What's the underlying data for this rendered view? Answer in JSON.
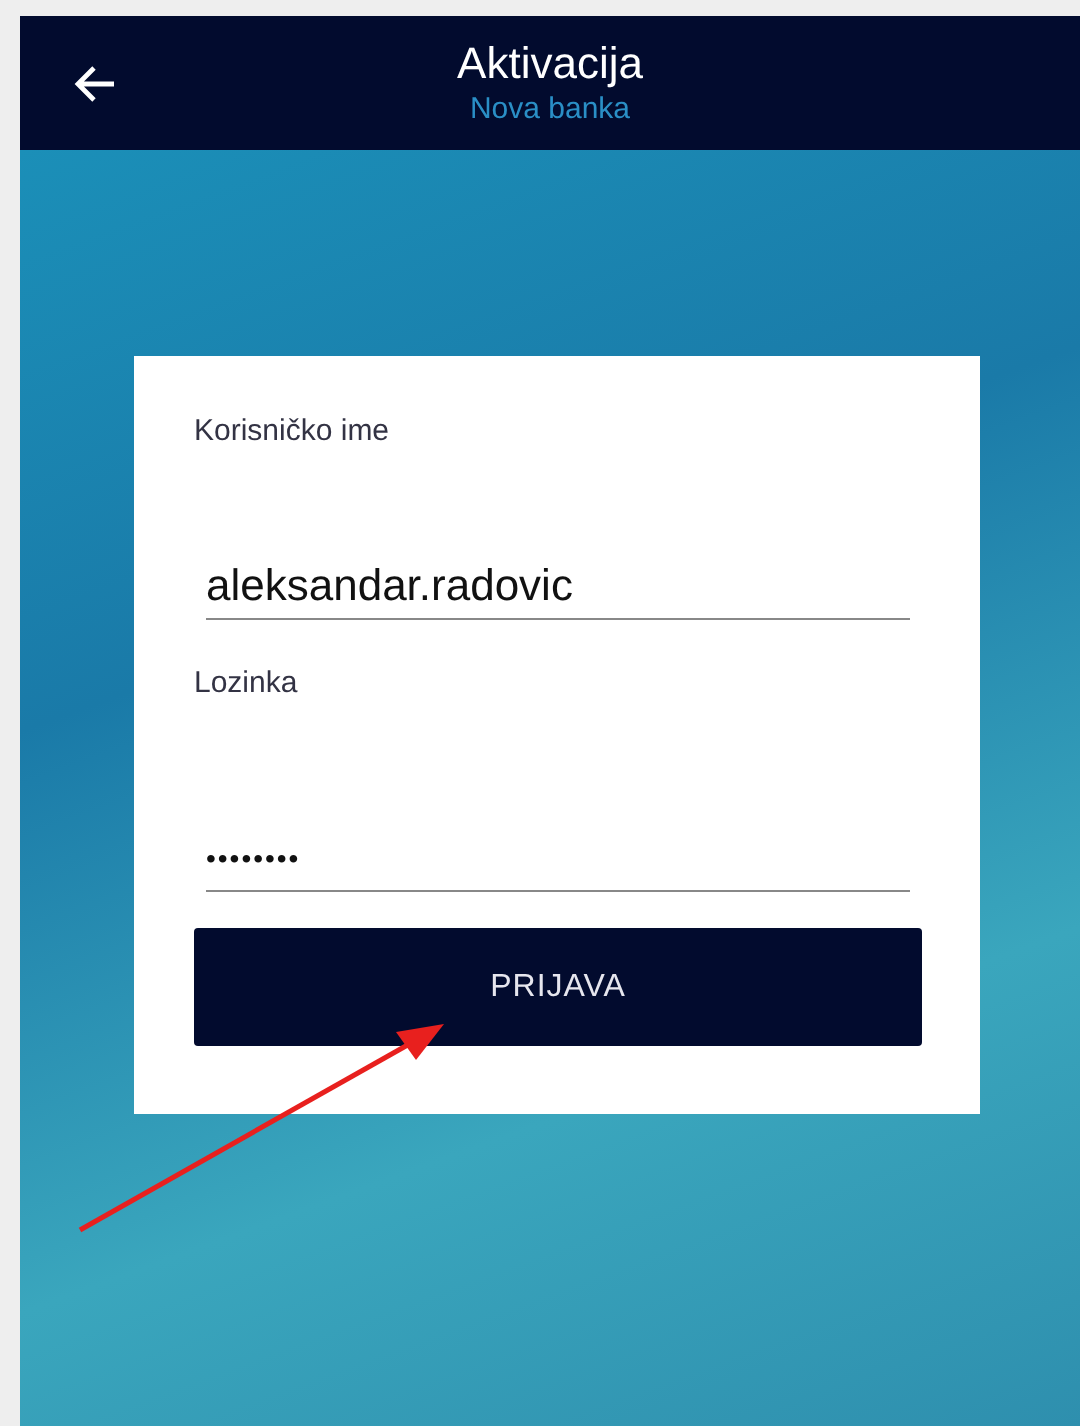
{
  "header": {
    "title": "Aktivacija",
    "subtitle": "Nova banka"
  },
  "form": {
    "fields": [
      {
        "label": "Korisničko ime",
        "value": "aleksandar.radovic"
      },
      {
        "label": "Lozinka",
        "value": "••••••••"
      }
    ],
    "button": "PRIJAVA"
  }
}
